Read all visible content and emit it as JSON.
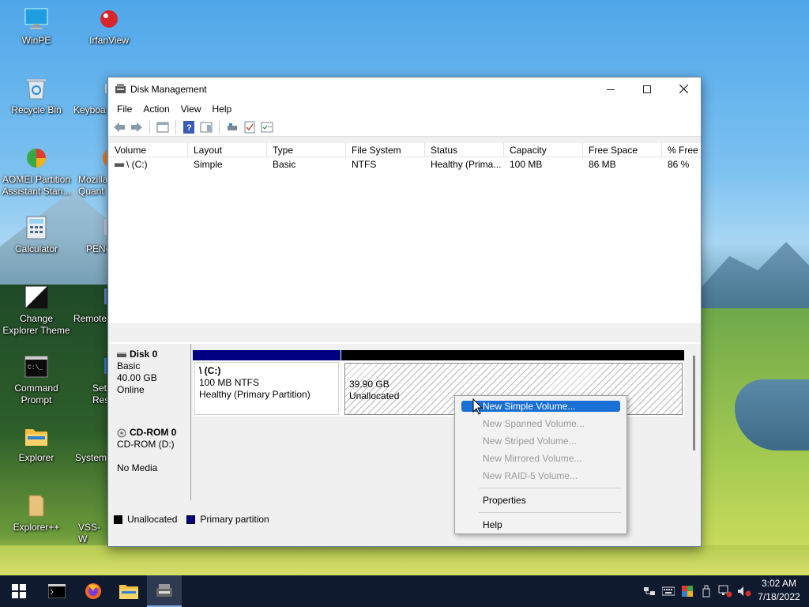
{
  "desktop": {
    "icons": [
      {
        "label": "WinPE"
      },
      {
        "label": "IrfanView"
      },
      {
        "label": "Recycle Bin"
      },
      {
        "label": "Keyboa"
      },
      {
        "label": "AOMEI Partition Assistant Stan..."
      },
      {
        "label": "Mozilla Quant"
      },
      {
        "label": "Calculator"
      },
      {
        "label": "PENe"
      },
      {
        "label": "Change Explorer Theme"
      },
      {
        "label": "Remote"
      },
      {
        "label": "Command Prompt"
      },
      {
        "label": "Set Reso"
      },
      {
        "label": "Explorer"
      },
      {
        "label": "System"
      },
      {
        "label": "Explorer++"
      },
      {
        "label": "VSS-W"
      }
    ]
  },
  "window": {
    "title": "Disk Management",
    "menu": [
      "File",
      "Action",
      "View",
      "Help"
    ],
    "columns": [
      "Volume",
      "Layout",
      "Type",
      "File System",
      "Status",
      "Capacity",
      "Free Space",
      "% Free"
    ],
    "rows": [
      [
        "\\ (C:)",
        "Simple",
        "Basic",
        "NTFS",
        "Healthy (Prima...",
        "100 MB",
        "86 MB",
        "86 %"
      ]
    ],
    "disks": {
      "disk0": {
        "name": "Disk 0",
        "type": "Basic",
        "size": "40.00 GB",
        "state": "Online",
        "partition_name": "\\ (C:)",
        "partition_info": "100 MB NTFS",
        "partition_status": "Healthy (Primary Partition)",
        "unalloc_size": "39.90 GB",
        "unalloc_label": "Unallocated"
      },
      "cdrom0": {
        "name": "CD-ROM 0",
        "type": "CD-ROM (D:)",
        "media": "No Media"
      }
    },
    "legend": {
      "unallocated": "Unallocated",
      "primary": "Primary partition",
      "unallocated_color": "#000000",
      "primary_color": "#000080"
    }
  },
  "context_menu": {
    "items": [
      {
        "label": "New Simple Volume...",
        "enabled": true
      },
      {
        "label": "New Spanned Volume...",
        "enabled": false
      },
      {
        "label": "New Striped Volume...",
        "enabled": false
      },
      {
        "label": "New Mirrored Volume...",
        "enabled": false
      },
      {
        "label": "New RAID-5 Volume...",
        "enabled": false
      },
      {
        "label": "Properties",
        "enabled": true
      },
      {
        "label": "Help",
        "enabled": true
      }
    ]
  },
  "taskbar": {
    "time": "3:02 AM",
    "date": "7/18/2022"
  }
}
